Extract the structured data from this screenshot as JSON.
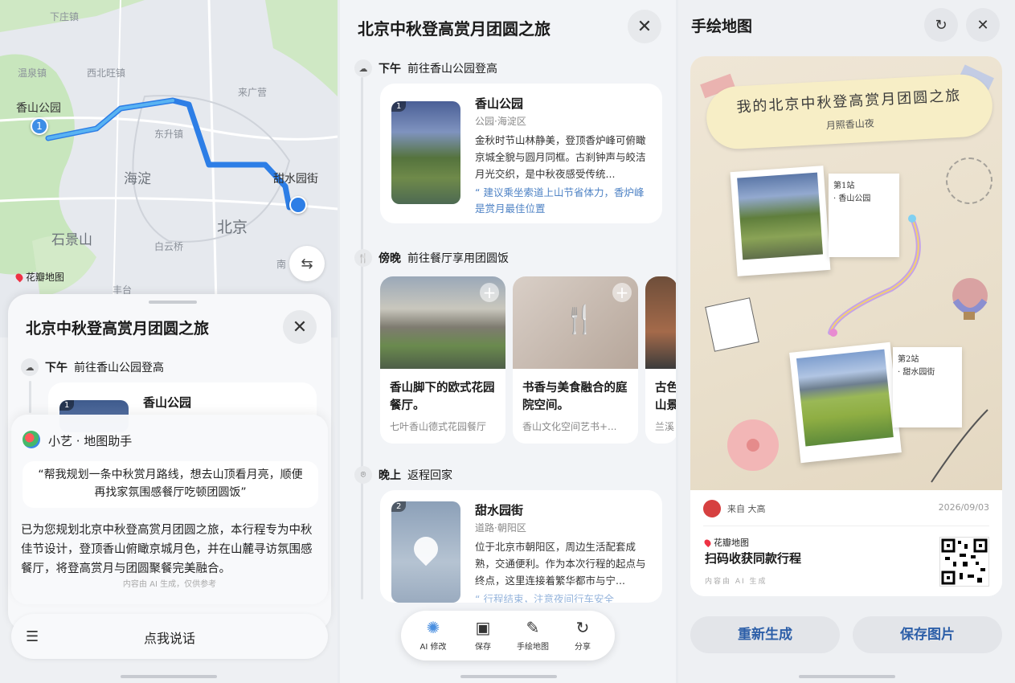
{
  "map": {
    "labels": [
      "下庄镇",
      "温泉镇",
      "西北旺镇",
      "来广营",
      "香山公园",
      "东升镇",
      "海淀",
      "甜水园街",
      "北京",
      "石景山",
      "白云桥",
      "南",
      "丰台"
    ],
    "brand": "花瓣地图",
    "route_colors": [
      "#2d7ee6",
      "#59b3f2"
    ],
    "start_num": "1"
  },
  "trip": {
    "title": "北京中秋登高赏月团圆之旅",
    "close_icon": "close-icon",
    "segments": [
      {
        "time": "下午",
        "desc": "前往香山公园登高"
      },
      {
        "time": "傍晚",
        "desc": "前往餐厅享用团圆饭"
      },
      {
        "time": "晚上",
        "desc": "返程回家"
      }
    ],
    "spots": [
      {
        "num": "1",
        "name": "香山公园",
        "sub": "公园·海淀区",
        "desc": "金秋时节山林静美，登顶香炉峰可俯瞰京城全貌与圆月同框。古刹钟声与皎洁月光交织，是中秋夜感受传统...",
        "tip": "建议乘坐索道上山节省体力，香炉峰是赏月最佳位置"
      },
      {
        "num": "2",
        "name": "甜水园街",
        "sub": "道路·朝阳区",
        "desc": "位于北京市朝阳区，周边生活配套成熟，交通便利。作为本次行程的起点与终点，这里连接着繁华都市与宁...",
        "tip": "行程结束，注意夜间行车安全"
      }
    ],
    "restaurants": [
      {
        "title": "香山脚下的欧式花园餐厅。",
        "sub": "七叶香山德式花园餐厅"
      },
      {
        "title": "书香与美食融合的庭院空间。",
        "sub": "香山文化空间艺书+..."
      },
      {
        "title": "古色山景",
        "sub": "兰溪"
      }
    ]
  },
  "assistant": {
    "name": "小艺 · 地图助手",
    "quote": "“帮我规划一条中秋赏月路线，想去山顶看月亮，顺便再找家氛围感餐厅吃顿团圆饭”",
    "answer": "已为您规划北京中秋登高赏月团圆之旅，本行程专为中秋佳节设计，登顶香山俯瞰京城月色，并在山麓寻访氛围感餐厅，将登高赏月与团圆聚餐完美融合。",
    "ai_note": "内容由 AI 生成，仅供参考",
    "talk_label": "点我说话"
  },
  "toolbar": {
    "items": [
      {
        "label": "AI 修改",
        "icon": "ai-sparkle-icon"
      },
      {
        "label": "保存",
        "icon": "save-icon"
      },
      {
        "label": "手绘地图",
        "icon": "magic-pen-icon"
      },
      {
        "label": "分享",
        "icon": "share-icon"
      }
    ]
  },
  "handmap": {
    "title": "手绘地图",
    "poster_title": "我的北京中秋登高赏月团圆之旅",
    "poster_sub": "月照香山夜",
    "stop1": "第1站\n· 香山公园",
    "stop2": "第2站\n· 甜水园街",
    "from": "来自 大高",
    "date": "2026/09/03",
    "brand": "花瓣地图",
    "scan": "扫码收获同款行程",
    "ai_gen": "内容由 AI 生成",
    "regen": "重新生成",
    "save": "保存图片"
  },
  "colors": {
    "accent": "#2d5fa8",
    "tip": "#4f83c5",
    "route": "#2d7ee6"
  }
}
